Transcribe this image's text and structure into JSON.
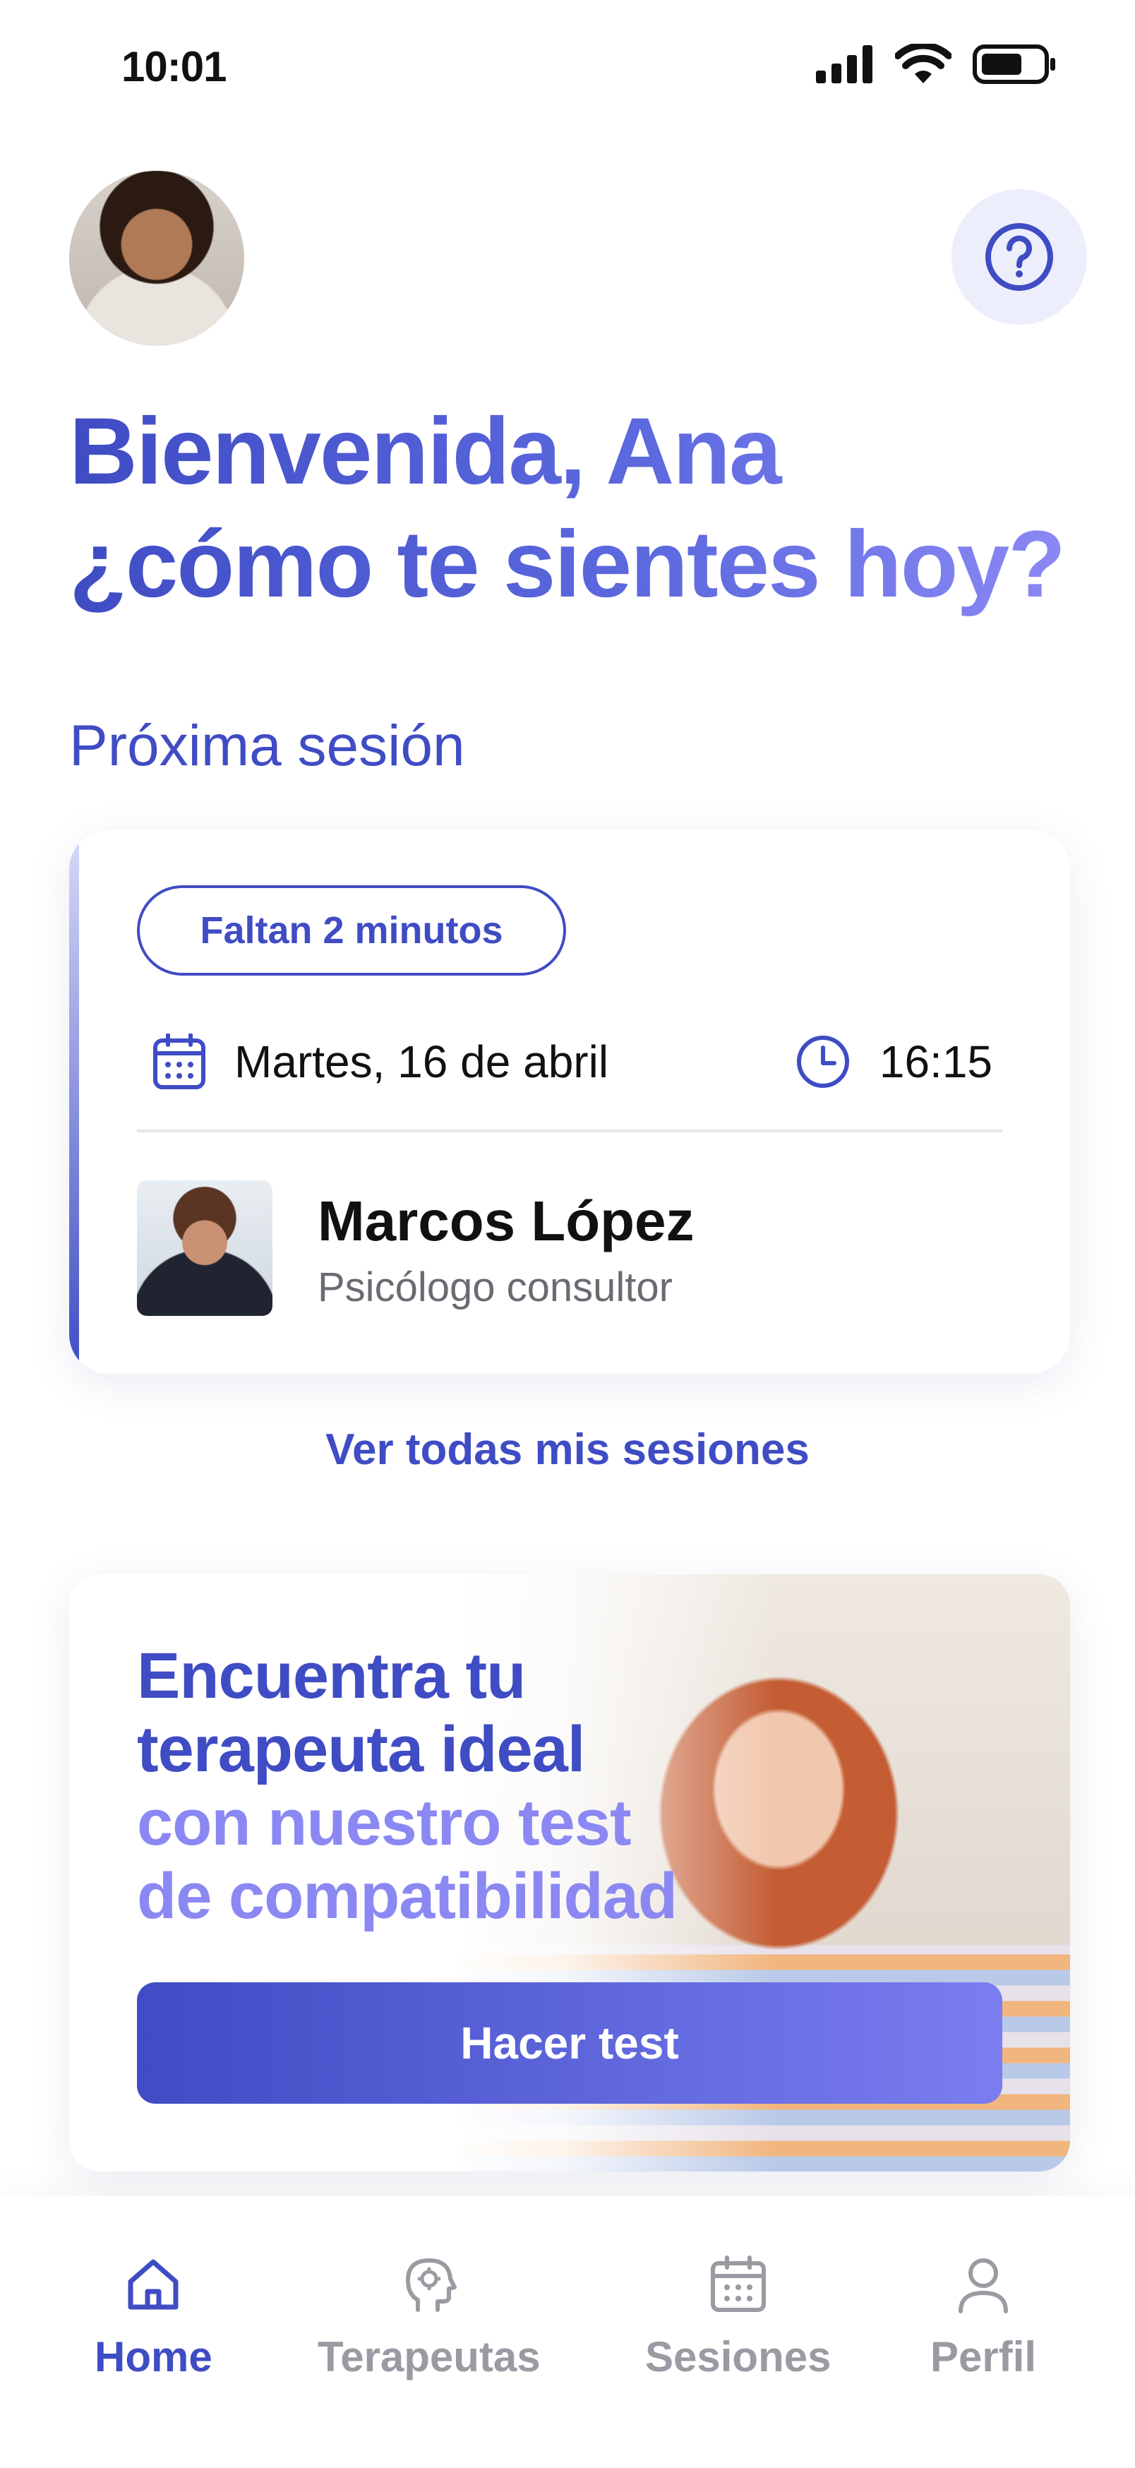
{
  "status_bar": {
    "time": "10:01"
  },
  "header": {
    "greeting_line1": "Bienvenida, Ana",
    "greeting_line2": "¿cómo te sientes hoy?"
  },
  "next_session": {
    "section_title": "Próxima sesión",
    "countdown": "Faltan 2 minutos",
    "date": "Martes, 16 de abril",
    "time": "16:15",
    "therapist_name": "Marcos López",
    "therapist_role": "Psicólogo consultor",
    "view_all": "Ver todas mis sesiones"
  },
  "promo": {
    "line1": "Encuentra tu",
    "line2": "terapeuta ideal",
    "line3": "con nuestro test",
    "line4": "de compatibilidad",
    "button": "Hacer test"
  },
  "bottom_nav": {
    "items": [
      {
        "label": "Home",
        "icon": "home-icon",
        "active": true
      },
      {
        "label": "Terapeutas",
        "icon": "therapist-head-icon",
        "active": false
      },
      {
        "label": "Sesiones",
        "icon": "calendar-icon",
        "active": false
      },
      {
        "label": "Perfil",
        "icon": "profile-icon",
        "active": false
      }
    ]
  },
  "colors": {
    "primary": "#3f4cc4",
    "primary_light": "#8b88f4",
    "nav_inactive": "#9a9aa2",
    "help_bg": "#eceefb"
  }
}
